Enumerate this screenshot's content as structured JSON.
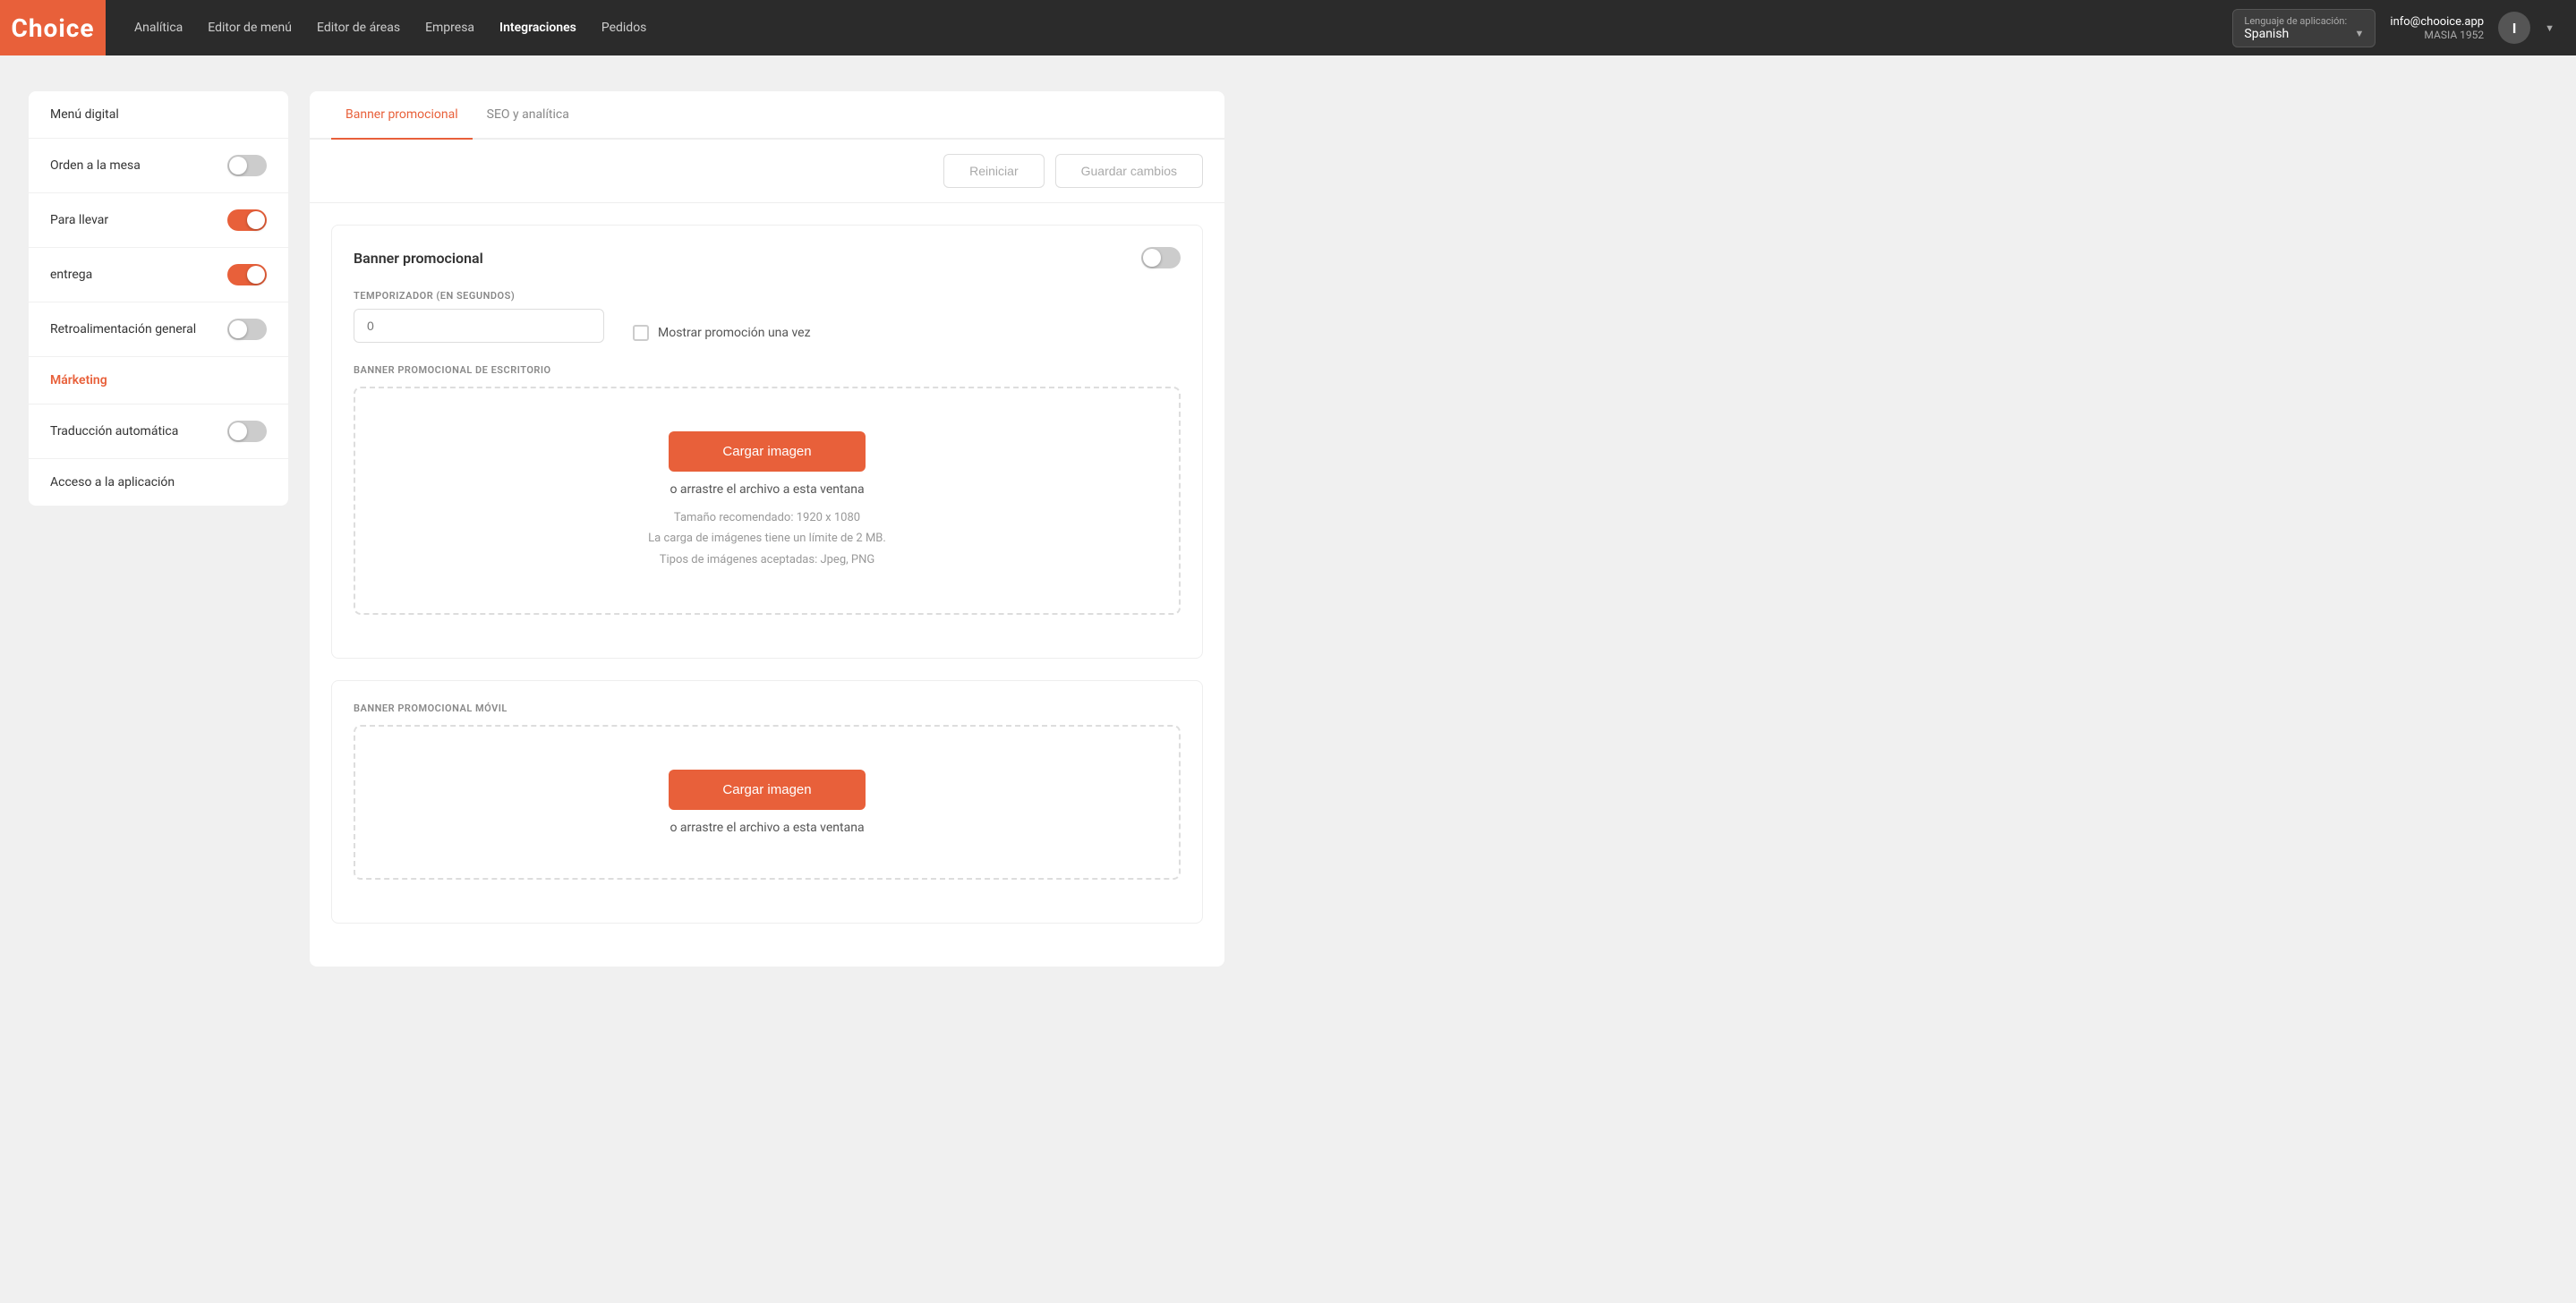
{
  "logo": "Choice",
  "nav": {
    "links": [
      {
        "label": "Analítica",
        "active": false
      },
      {
        "label": "Editor de menú",
        "active": false
      },
      {
        "label": "Editor de áreas",
        "active": false
      },
      {
        "label": "Empresa",
        "active": false
      },
      {
        "label": "Integraciones",
        "active": true
      },
      {
        "label": "Pedidos",
        "active": false
      }
    ]
  },
  "language_selector": {
    "label": "Lenguaje de aplicación:",
    "value": "Spanish"
  },
  "user": {
    "email": "info@chooice.app",
    "org": "MASIA 1952",
    "avatar_letter": "I"
  },
  "sidebar": {
    "items": [
      {
        "id": "menu-digital",
        "label": "Menú digital",
        "has_toggle": false,
        "toggle_on": false,
        "active": false
      },
      {
        "id": "orden-mesa",
        "label": "Orden a la mesa",
        "has_toggle": true,
        "toggle_on": false,
        "active": false
      },
      {
        "id": "para-llevar",
        "label": "Para llevar",
        "has_toggle": true,
        "toggle_on": true,
        "active": false
      },
      {
        "id": "entrega",
        "label": "entrega",
        "has_toggle": true,
        "toggle_on": true,
        "active": false
      },
      {
        "id": "retroalimentacion",
        "label": "Retroalimentación general",
        "has_toggle": true,
        "toggle_on": false,
        "active": false
      },
      {
        "id": "marketing",
        "label": "Márketing",
        "has_toggle": false,
        "toggle_on": false,
        "active": true
      },
      {
        "id": "traduccion",
        "label": "Traducción automática",
        "has_toggle": true,
        "toggle_on": false,
        "active": false
      },
      {
        "id": "acceso",
        "label": "Acceso a la aplicación",
        "has_toggle": false,
        "toggle_on": false,
        "active": false
      }
    ]
  },
  "tabs": [
    {
      "id": "banner",
      "label": "Banner promocional",
      "active": true
    },
    {
      "id": "seo",
      "label": "SEO y analítica",
      "active": false
    }
  ],
  "toolbar": {
    "reiniciar_label": "Reiniciar",
    "guardar_label": "Guardar cambios"
  },
  "banner_section": {
    "title": "Banner promocional",
    "toggle_on": false,
    "timer_label": "TEMPORIZADOR (EN SEGUNDOS)",
    "timer_placeholder": "0",
    "show_once_label": "Mostrar promoción una vez",
    "desktop_label": "BANNER PROMOCIONAL DE ESCRITORIO",
    "desktop_upload_btn": "Cargar imagen",
    "desktop_or": "o arrastre el archivo a esta ventana",
    "desktop_hint1": "Tamaño recomendado: 1920 x 1080",
    "desktop_hint2": "La carga de imágenes tiene un límite de 2 MB.",
    "desktop_hint3": "Tipos de imágenes aceptadas: Jpeg, PNG",
    "mobile_label": "BANNER PROMOCIONAL MÓVIL",
    "mobile_upload_btn": "Cargar imagen",
    "mobile_or": "o arrastre el archivo a esta ventana"
  },
  "colors": {
    "accent": "#e8603a",
    "active_nav": "#ffffff",
    "active_sidebar": "#e8603a"
  }
}
